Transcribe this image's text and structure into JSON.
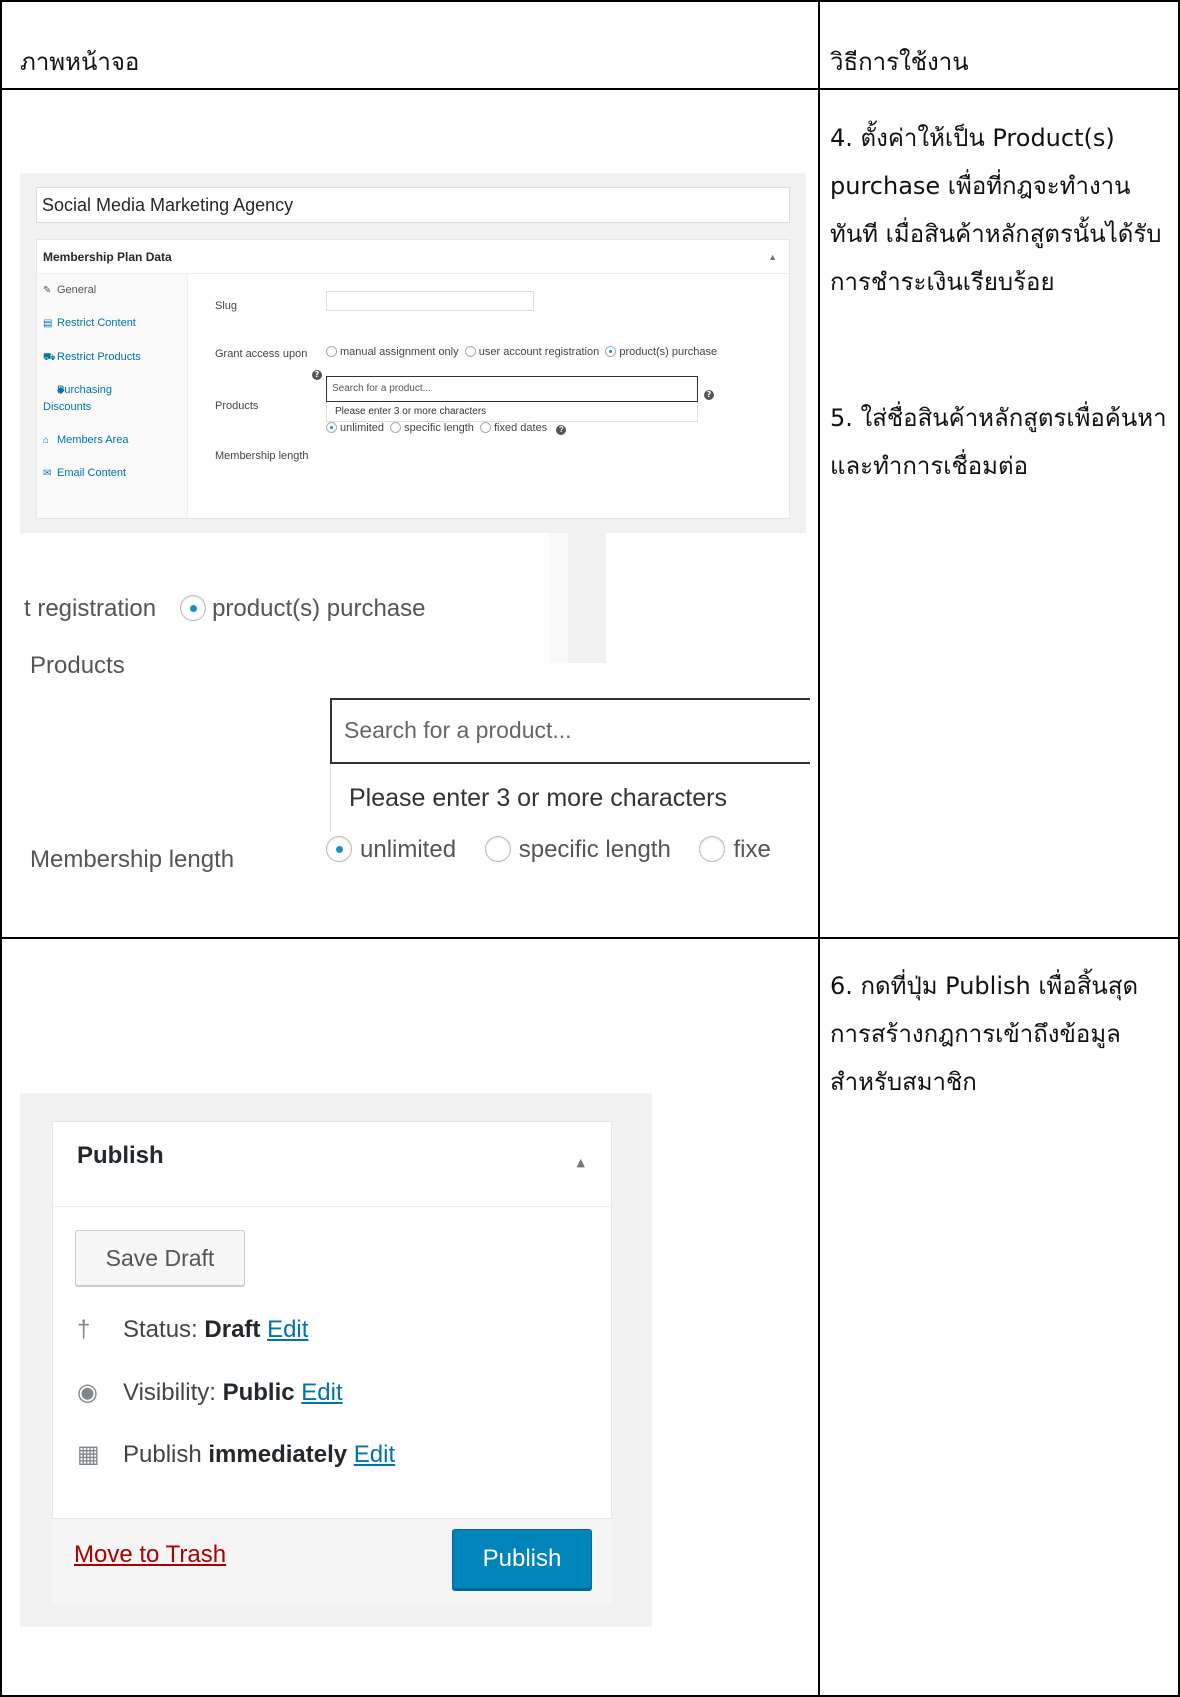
{
  "header": {
    "col_screen": "ภาพหน้าจอ",
    "col_usage": "วิธีการใช้งาน"
  },
  "instructions": {
    "step4": "4. ตั้งค่าให้เป็น Product(s) purchase เพื่อที่กฎจะทำงานทันที เมื่อสินค้าหลักสูตรนั้นได้รับการชำระเงินเรียบร้อย",
    "step5": "5. ใส่ชื่อสินค้าหลักสูตรเพื่อค้นหา และทำการเชื่อมต่อ",
    "step6": "6. กดที่ปุ่ม Publish เพื่อสิ้นสุดการสร้างกฎการเข้าถึงข้อมูลสำหรับสมาชิก"
  },
  "membership_screen": {
    "plan_title": "Social Media Marketing Agency",
    "panel_title": "Membership Plan Data",
    "tabs": [
      {
        "label": "General",
        "icon": "wrench-icon"
      },
      {
        "label": "Restrict Content",
        "icon": "content-icon"
      },
      {
        "label": "Restrict Products",
        "icon": "cart-icon"
      },
      {
        "label": "Purchasing Discounts",
        "icon": "tag-icon"
      },
      {
        "label": "Members Area",
        "icon": "home-icon"
      },
      {
        "label": "Email Content",
        "icon": "email-icon"
      }
    ],
    "fields": {
      "slug_label": "Slug",
      "grant_label": "Grant access upon",
      "grant_options": [
        "manual assignment only",
        "user account registration",
        "product(s) purchase"
      ],
      "grant_selected": "product(s) purchase",
      "products_label": "Products",
      "search_placeholder": "Search for a product...",
      "search_hint": "Please enter 3 or more characters",
      "length_label": "Membership length",
      "length_options": [
        "unlimited",
        "specific length",
        "fixed dates"
      ],
      "length_selected": "unlimited"
    }
  },
  "zoom_crop_1": {
    "partial_option": "t registration",
    "selected_option": "product(s) purchase"
  },
  "zoom_crop_2": {
    "products_label": "Products",
    "search_placeholder": "Search for a product...",
    "search_hint": "Please enter 3 or more characters",
    "length_label": "Membership length",
    "options": [
      "unlimited",
      "specific length",
      "fixe"
    ]
  },
  "publish_box": {
    "title": "Publish",
    "save_draft": "Save Draft",
    "status_label": "Status:",
    "status_value": "Draft",
    "visibility_label": "Visibility:",
    "visibility_value": "Public",
    "publish_label": "Publish",
    "publish_value": "immediately",
    "edit_link": "Edit",
    "move_to_trash": "Move to Trash",
    "publish_button": "Publish"
  },
  "colors": {
    "link": "#0073aa",
    "primary_button": "#0085ba",
    "trash": "#a00",
    "radio_selected": "#1e8cbe"
  }
}
